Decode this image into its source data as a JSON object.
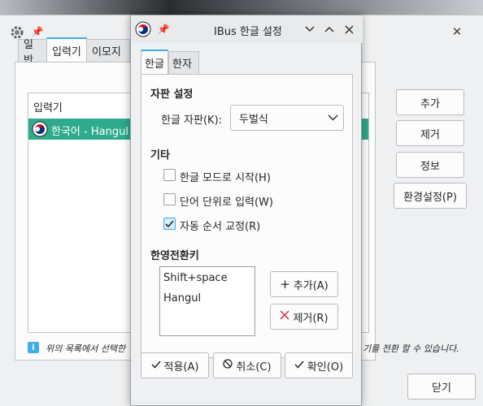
{
  "bg_window": {
    "tabs": [
      "일반",
      "입력기",
      "이모지"
    ],
    "list_header": "입력기",
    "selected_engine": "한국어 - Hangul",
    "buttons": {
      "add": "추가",
      "remove": "제거",
      "info": "정보",
      "settings": "환경설정(P)",
      "close": "닫기"
    },
    "info_left": "위의 목록에서 선택한",
    "info_right": "기를 전환 할 수 있습니다."
  },
  "dialog": {
    "title": "IBus 한글 설정",
    "tabs": [
      "한글",
      "한자"
    ],
    "layout_section": "자판 설정",
    "layout_label": "한글 자판(K):",
    "layout_value": "두벌식",
    "etc_section": "기타",
    "options": [
      {
        "label": "한글 모드로 시작(H)",
        "checked": false
      },
      {
        "label": "단어 단위로 입력(W)",
        "checked": false
      },
      {
        "label": "자동 순서 교정(R)",
        "checked": true
      }
    ],
    "hotkey_section": "한영전환키",
    "hotkeys": [
      "Shift+space",
      "Hangul"
    ],
    "hotkey_add": "추가(A)",
    "hotkey_remove": "제거(R)",
    "apply": "적용(A)",
    "cancel": "취소(C)",
    "ok": "확인(O)"
  },
  "colors": {
    "accent": "#3daee9",
    "selection": "#2eaa8c",
    "remove_red": "#da4453"
  }
}
